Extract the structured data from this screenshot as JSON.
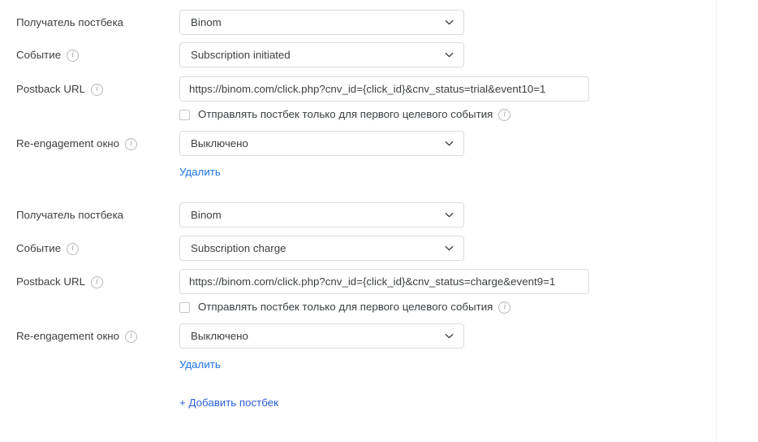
{
  "form": {
    "labels": {
      "recipient": "Получатель постбека",
      "event": "Событие",
      "postback_url": "Postback URL",
      "reengagement": "Re-engagement окно"
    },
    "checkbox_label": "Отправлять постбек только для первого целевого события",
    "delete_link": "Удалить",
    "add_link": "+ Добавить постбек",
    "info_glyph": "i",
    "chevron_icon": "chevron-down-icon"
  },
  "postbacks": [
    {
      "recipient": "Binom",
      "event": "Subscription initiated",
      "postback_url": "https://binom.com/click.php?cnv_id={click_id}&cnv_status=trial&event10=1",
      "first_event_only_checked": false,
      "reengagement_window": "Выключено"
    },
    {
      "recipient": "Binom",
      "event": "Subscription charge",
      "postback_url": "https://binom.com/click.php?cnv_id={click_id}&cnv_status=charge&event9=1",
      "first_event_only_checked": false,
      "reengagement_window": "Выключено"
    }
  ],
  "colors": {
    "link": "#1a73e8",
    "add_link": "#2b5fd9",
    "border": "#dadce0",
    "text": "#3c4043",
    "divider": "#eceff1"
  }
}
